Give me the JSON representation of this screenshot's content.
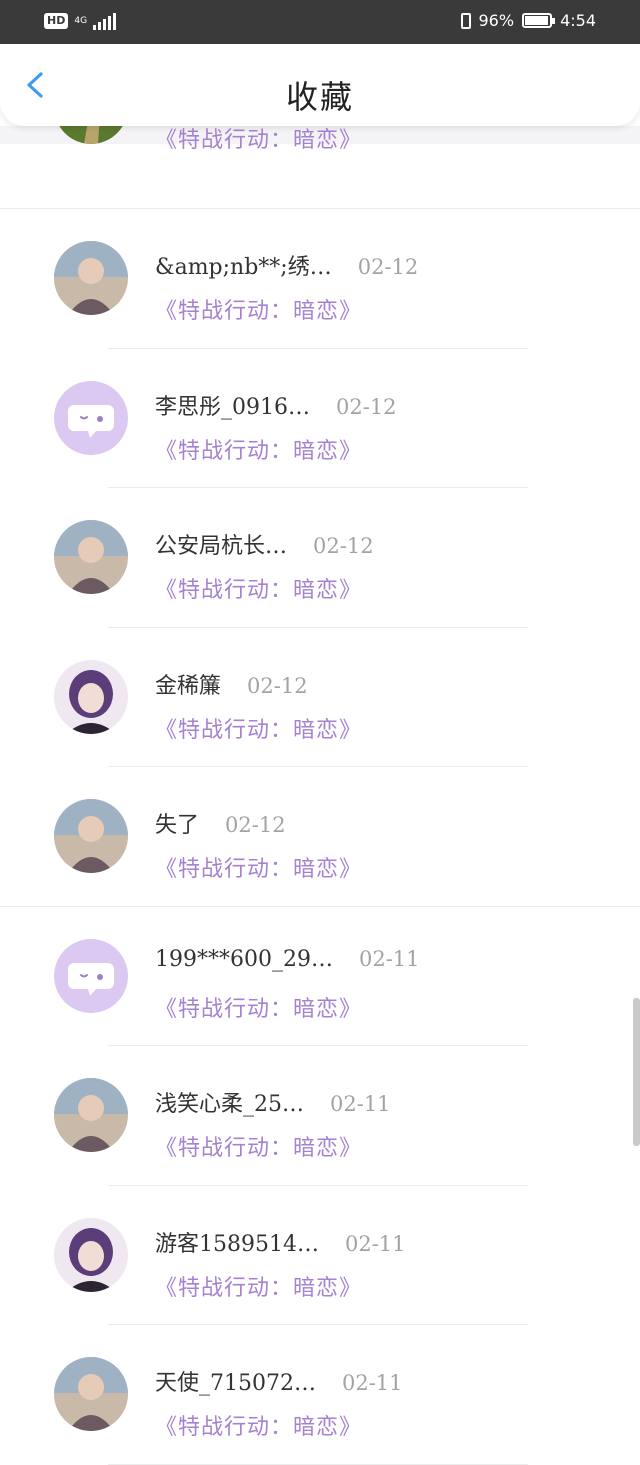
{
  "status_bar": {
    "hd": "HD",
    "network": "4G",
    "battery_percent": "96%",
    "battery_level": 0.96,
    "time": "4:54"
  },
  "header": {
    "back_icon": "chevron-left-icon",
    "title": "收藏"
  },
  "colors": {
    "accent_link": "#a582d0",
    "back_icon": "#3b9cf1",
    "name_text": "#333333",
    "date_text": "#a3a3a3",
    "default_avatar_bg": "#dcc9f2"
  },
  "favorites": [
    {
      "name": "",
      "date": "",
      "link": "《特战行动：暗恋》",
      "avatar": "photo-nature"
    },
    {
      "name": "&amp;nb**;绣…",
      "date": "02-12",
      "link": "《特战行动：暗恋》",
      "avatar": "photo-person"
    },
    {
      "name": "李思彤_0916…",
      "date": "02-12",
      "link": "《特战行动：暗恋》",
      "avatar": "default-chat-icon"
    },
    {
      "name": "公安局杭长…",
      "date": "02-12",
      "link": "《特战行动：暗恋》",
      "avatar": "photo-person"
    },
    {
      "name": "金稀簾",
      "date": "02-12",
      "link": "《特战行动：暗恋》",
      "avatar": "photo-anime"
    },
    {
      "name": "失了",
      "date": "02-12",
      "link": "《特战行动：暗恋》",
      "avatar": "photo-person"
    },
    {
      "name": "199***600_29…",
      "date": "02-11",
      "link": "《特战行动：暗恋》",
      "avatar": "default-chat-icon"
    },
    {
      "name": "浅笑心柔_25…",
      "date": "02-11",
      "link": "《特战行动：暗恋》",
      "avatar": "photo-person"
    },
    {
      "name": "游客1589514…",
      "date": "02-11",
      "link": "《特战行动：暗恋》",
      "avatar": "photo-anime"
    },
    {
      "name": "天使_715072…",
      "date": "02-11",
      "link": "《特战行动：暗恋》",
      "avatar": "photo-person"
    }
  ]
}
